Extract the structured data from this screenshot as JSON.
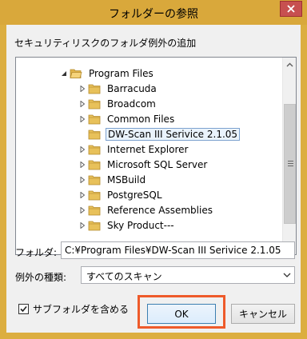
{
  "window": {
    "title": "フォルダーの参照"
  },
  "dialog": {
    "description": "セキュリティリスクのフォルダ例外の追加"
  },
  "tree": {
    "parent": "Program Files",
    "items": [
      {
        "label": "Barracuda",
        "selected": false
      },
      {
        "label": "Broadcom",
        "selected": false
      },
      {
        "label": "Common Files",
        "selected": false
      },
      {
        "label": "DW-Scan III Serivice 2.1.05",
        "selected": true
      },
      {
        "label": "Internet Explorer",
        "selected": false
      },
      {
        "label": "Microsoft SQL Server",
        "selected": false
      },
      {
        "label": "MSBuild",
        "selected": false
      },
      {
        "label": "PostgreSQL",
        "selected": false
      },
      {
        "label": "Reference Assemblies",
        "selected": false
      },
      {
        "label": "Sky Product---",
        "selected": false
      }
    ]
  },
  "folder_field": {
    "label": "フォルダ:",
    "value": "C:¥Program Files¥DW-Scan III Serivice 2.1.05"
  },
  "exception_type": {
    "label": "例外の種類:",
    "selected": "すべてのスキャン"
  },
  "subfolder_checkbox": {
    "label": "サブフォルダを含める",
    "checked": true
  },
  "buttons": {
    "ok": "OK",
    "cancel": "キャンセル"
  },
  "colors": {
    "title_bar": "#d9a83b",
    "close_button": "#c75050",
    "highlight": "#ee5a2a",
    "folder": "#e8c15a",
    "selection_border": "#7da2ce"
  }
}
